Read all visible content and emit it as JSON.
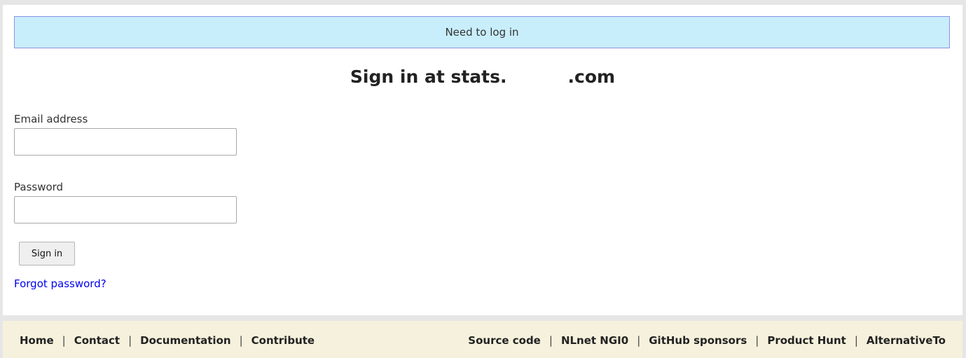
{
  "notice": {
    "text": "Need to log in"
  },
  "heading": {
    "text": "Sign in at stats.          .com"
  },
  "form": {
    "email_label": "Email address",
    "email_value": "",
    "password_label": "Password",
    "password_value": "",
    "submit_label": "Sign in",
    "forgot_label": "Forgot password?"
  },
  "footer": {
    "left_links": [
      "Home",
      "Contact",
      "Documentation",
      "Contribute"
    ],
    "right_links": [
      "Source code",
      "NLnet NGI0",
      "GitHub sponsors",
      "Product Hunt",
      "AlternativeTo"
    ],
    "separator": "|"
  }
}
